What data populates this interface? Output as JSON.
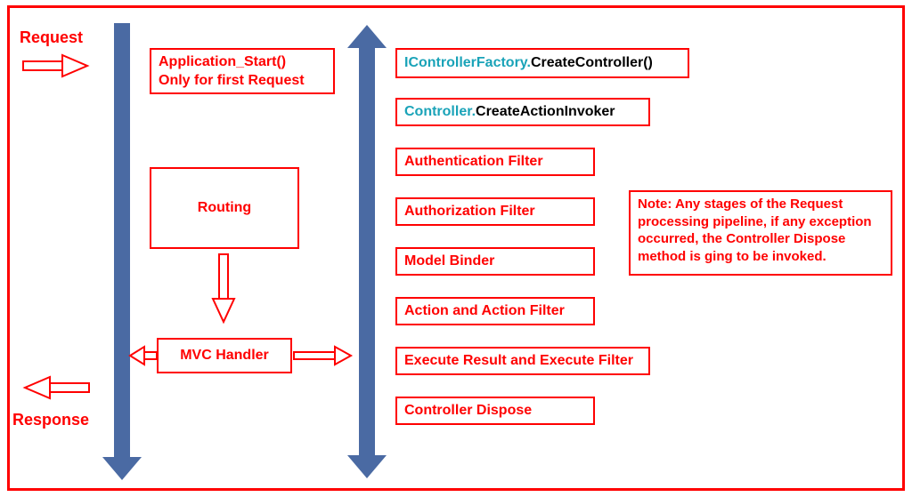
{
  "labels": {
    "request": "Request",
    "response": "Response"
  },
  "col1": {
    "appstart_line1": "Application_Start()",
    "appstart_line2": "Only for first Request",
    "routing": "Routing",
    "mvchandler": "MVC Handler"
  },
  "col2": {
    "line1_teal": "IControllerFactory.",
    "line1_black": "CreateController()",
    "line2_teal": "Controller.",
    "line2_black": "CreateActionInvoker",
    "auth_filter": "Authentication Filter",
    "authz_filter": "Authorization Filter",
    "model_binder": "Model Binder",
    "action_filter": "Action and Action Filter",
    "exec_result": "Execute Result and Execute Filter",
    "dispose": "Controller Dispose"
  },
  "note": "Note: Any stages of the Request processing pipeline, if any exception occurred, the Controller Dispose method is ging to be invoked.",
  "chart_data": {
    "type": "flow-diagram",
    "entry": "Request",
    "exit": "Response",
    "left_pipeline": [
      "Application_Start() (first request only)",
      "Routing",
      "MVC Handler"
    ],
    "right_pipeline": [
      "IControllerFactory.CreateController()",
      "Controller.CreateActionInvoker",
      "Authentication Filter",
      "Authorization Filter",
      "Model Binder",
      "Action and Action Filter",
      "Execute Result and Execute Filter",
      "Controller Dispose"
    ],
    "note": "Any stage exception invokes Controller Dispose",
    "edges": [
      [
        "Request",
        "left vertical arrow"
      ],
      [
        "Routing",
        "MVC Handler"
      ],
      [
        "MVC Handler",
        "right vertical arrow (bidirectional)"
      ],
      [
        "left vertical arrow",
        "Response"
      ]
    ]
  }
}
